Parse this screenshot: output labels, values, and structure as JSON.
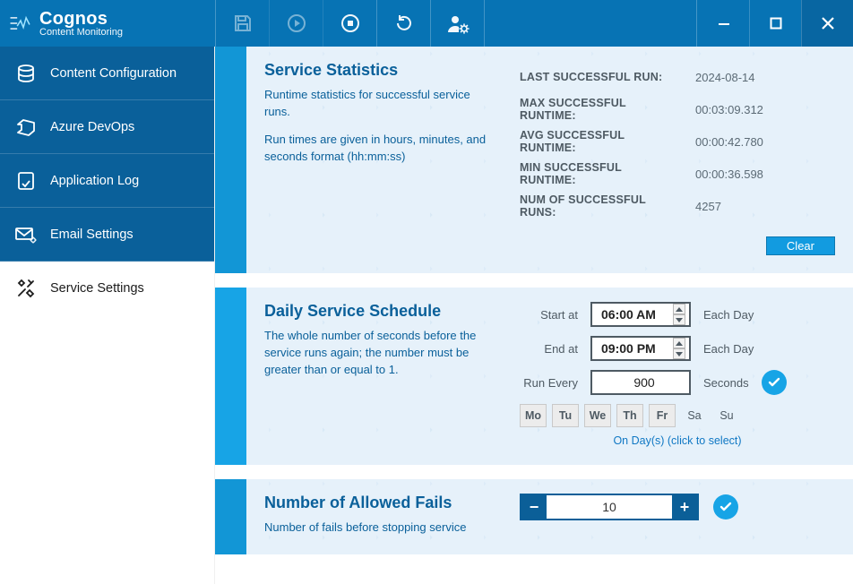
{
  "brand": {
    "title": "Cognos",
    "subtitle": "Content Monitoring"
  },
  "sidebar": {
    "items": [
      {
        "label": "Content Configuration"
      },
      {
        "label": "Azure DevOps"
      },
      {
        "label": "Application Log"
      },
      {
        "label": "Email Settings"
      },
      {
        "label": "Service Settings"
      }
    ]
  },
  "statistics": {
    "heading": "Service Statistics",
    "desc1": "Runtime statistics for successful service runs.",
    "desc2": "Run times are given in hours, minutes, and seconds format (hh:mm:ss)",
    "rows": [
      {
        "label": "LAST SUCCESSFUL RUN:",
        "value": "2024-08-14"
      },
      {
        "label": "MAX SUCCESSFUL RUNTIME:",
        "value": "00:03:09.312"
      },
      {
        "label": "AVG SUCCESSFUL RUNTIME:",
        "value": "00:00:42.780"
      },
      {
        "label": "MIN SUCCESSFUL RUNTIME:",
        "value": "00:00:36.598"
      },
      {
        "label": "NUM OF SUCCESSFUL RUNS:",
        "value": "4257"
      }
    ],
    "clear_label": "Clear"
  },
  "schedule": {
    "heading": "Daily Service Schedule",
    "desc": "The whole number of seconds before the service runs again; the number must be greater than or equal to 1.",
    "start_label": "Start at",
    "start_value": "06:00 AM",
    "end_label": "End at",
    "end_value": "09:00 PM",
    "each_day": "Each Day",
    "run_every_label": "Run Every",
    "run_every_value": "900",
    "seconds_label": "Seconds",
    "days": [
      "Mo",
      "Tu",
      "We",
      "Th",
      "Fr",
      "Sa",
      "Su"
    ],
    "days_selected": [
      true,
      true,
      true,
      true,
      true,
      false,
      false
    ],
    "hint": "On Day(s) (click to select)"
  },
  "fails": {
    "heading": "Number of Allowed Fails",
    "desc": "Number of fails before stopping service",
    "value": "10"
  }
}
